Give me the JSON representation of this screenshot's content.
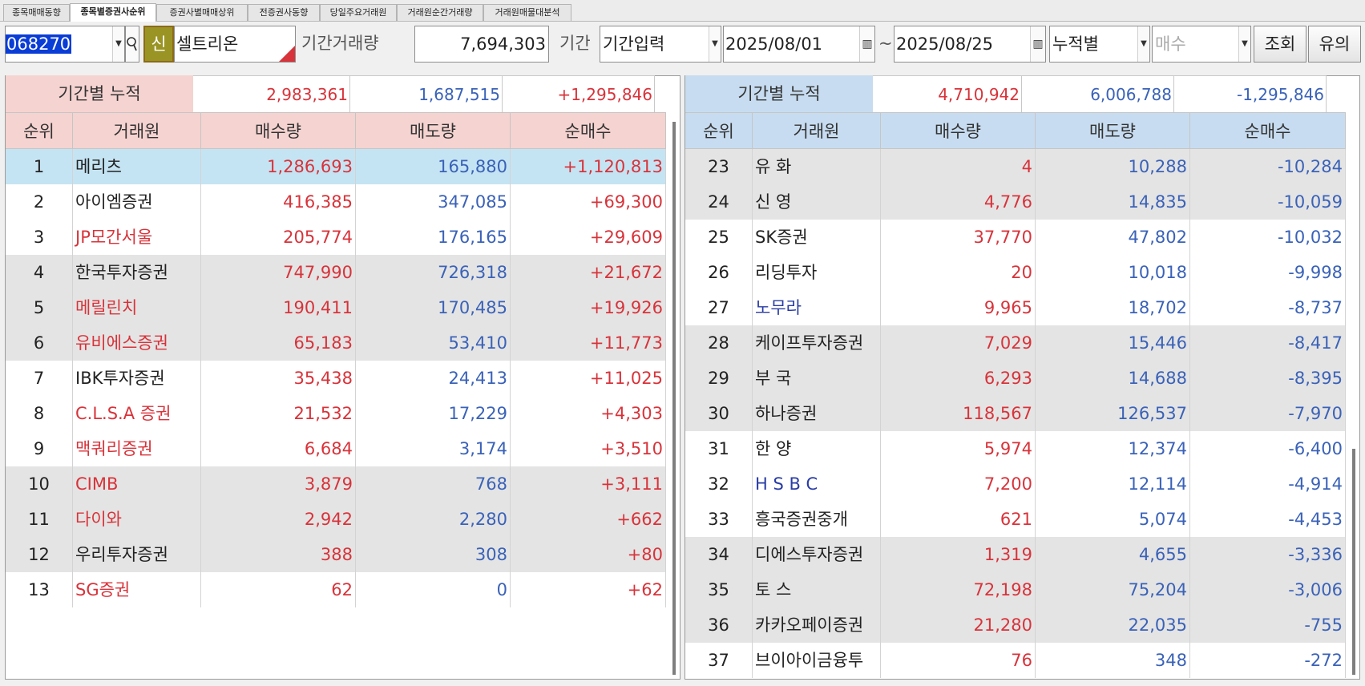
{
  "tabs": [
    "종목매매동향",
    "종목별증권사순위",
    "증권사별매매상위",
    "전증권사동향",
    "당일주요거래원",
    "거래원순간거래량",
    "거래원매물대분석"
  ],
  "active_tab": 1,
  "toolbar": {
    "code": "068270",
    "badge": "신",
    "stock_name": "셀트리온",
    "volume_label": "기간거래량",
    "volume_value": "7,694,303",
    "period_label": "기간",
    "period_mode": "기간입력",
    "date_from": "2025/08/01",
    "tilde": "~",
    "date_to": "2025/08/25",
    "accum_mode": "누적별",
    "side": "매수",
    "query_btn": "조회",
    "note_btn": "유의"
  },
  "left": {
    "cum_label": "기간별 누적",
    "cum_buy": "2,983,361",
    "cum_sell": "1,687,515",
    "cum_net": "+1,295,846",
    "headers": [
      "순위",
      "거래원",
      "매수량",
      "매도량",
      "순매수"
    ],
    "rows": [
      {
        "rank": "1",
        "name": "메리츠",
        "buy": "1,286,693",
        "sell": "165,880",
        "net": "+1,120,813",
        "name_color": "dark",
        "bg": "sel"
      },
      {
        "rank": "2",
        "name": "아이엠증권",
        "buy": "416,385",
        "sell": "347,085",
        "net": "+69,300",
        "name_color": "dark",
        "bg": "white"
      },
      {
        "rank": "3",
        "name": "JP모간서울",
        "buy": "205,774",
        "sell": "176,165",
        "net": "+29,609",
        "name_color": "red",
        "bg": "white"
      },
      {
        "rank": "4",
        "name": "한국투자증권",
        "buy": "747,990",
        "sell": "726,318",
        "net": "+21,672",
        "name_color": "dark",
        "bg": "gray"
      },
      {
        "rank": "5",
        "name": "메릴린치",
        "buy": "190,411",
        "sell": "170,485",
        "net": "+19,926",
        "name_color": "red",
        "bg": "gray"
      },
      {
        "rank": "6",
        "name": "유비에스증권",
        "buy": "65,183",
        "sell": "53,410",
        "net": "+11,773",
        "name_color": "red",
        "bg": "gray"
      },
      {
        "rank": "7",
        "name": "IBK투자증권",
        "buy": "35,438",
        "sell": "24,413",
        "net": "+11,025",
        "name_color": "dark",
        "bg": "white"
      },
      {
        "rank": "8",
        "name": "C.L.S.A 증권",
        "buy": "21,532",
        "sell": "17,229",
        "net": "+4,303",
        "name_color": "red",
        "bg": "white"
      },
      {
        "rank": "9",
        "name": "맥쿼리증권",
        "buy": "6,684",
        "sell": "3,174",
        "net": "+3,510",
        "name_color": "red",
        "bg": "white"
      },
      {
        "rank": "10",
        "name": "CIMB",
        "buy": "3,879",
        "sell": "768",
        "net": "+3,111",
        "name_color": "red",
        "bg": "gray"
      },
      {
        "rank": "11",
        "name": "다이와",
        "buy": "2,942",
        "sell": "2,280",
        "net": "+662",
        "name_color": "red",
        "bg": "gray"
      },
      {
        "rank": "12",
        "name": "우리투자증권",
        "buy": "388",
        "sell": "308",
        "net": "+80",
        "name_color": "dark",
        "bg": "gray"
      },
      {
        "rank": "13",
        "name": "SG증권",
        "buy": "62",
        "sell": "0",
        "net": "+62",
        "name_color": "red",
        "bg": "white"
      }
    ]
  },
  "right": {
    "cum_label": "기간별 누적",
    "cum_buy": "4,710,942",
    "cum_sell": "6,006,788",
    "cum_net": "-1,295,846",
    "headers": [
      "순위",
      "거래원",
      "매수량",
      "매도량",
      "순매수"
    ],
    "rows": [
      {
        "rank": "23",
        "name": "유 화",
        "buy": "4",
        "sell": "10,288",
        "net": "-10,284",
        "name_color": "dark",
        "bg": "gray"
      },
      {
        "rank": "24",
        "name": "신 영",
        "buy": "4,776",
        "sell": "14,835",
        "net": "-10,059",
        "name_color": "dark",
        "bg": "gray"
      },
      {
        "rank": "25",
        "name": "SK증권",
        "buy": "37,770",
        "sell": "47,802",
        "net": "-10,032",
        "name_color": "dark",
        "bg": "white"
      },
      {
        "rank": "26",
        "name": "리딩투자",
        "buy": "20",
        "sell": "10,018",
        "net": "-9,998",
        "name_color": "dark",
        "bg": "white"
      },
      {
        "rank": "27",
        "name": "노무라",
        "buy": "9,965",
        "sell": "18,702",
        "net": "-8,737",
        "name_color": "navy",
        "bg": "white"
      },
      {
        "rank": "28",
        "name": "케이프투자증권",
        "buy": "7,029",
        "sell": "15,446",
        "net": "-8,417",
        "name_color": "dark",
        "bg": "gray"
      },
      {
        "rank": "29",
        "name": "부 국",
        "buy": "6,293",
        "sell": "14,688",
        "net": "-8,395",
        "name_color": "dark",
        "bg": "gray"
      },
      {
        "rank": "30",
        "name": "하나증권",
        "buy": "118,567",
        "sell": "126,537",
        "net": "-7,970",
        "name_color": "dark",
        "bg": "gray"
      },
      {
        "rank": "31",
        "name": "한 양",
        "buy": "5,974",
        "sell": "12,374",
        "net": "-6,400",
        "name_color": "dark",
        "bg": "white"
      },
      {
        "rank": "32",
        "name": "H S B C",
        "buy": "7,200",
        "sell": "12,114",
        "net": "-4,914",
        "name_color": "navy",
        "bg": "white"
      },
      {
        "rank": "33",
        "name": "흥국증권중개",
        "buy": "621",
        "sell": "5,074",
        "net": "-4,453",
        "name_color": "dark",
        "bg": "white"
      },
      {
        "rank": "34",
        "name": "디에스투자증권",
        "buy": "1,319",
        "sell": "4,655",
        "net": "-3,336",
        "name_color": "dark",
        "bg": "gray"
      },
      {
        "rank": "35",
        "name": "토 스",
        "buy": "72,198",
        "sell": "75,204",
        "net": "-3,006",
        "name_color": "dark",
        "bg": "gray"
      },
      {
        "rank": "36",
        "name": "카카오페이증권",
        "buy": "21,280",
        "sell": "22,035",
        "net": "-755",
        "name_color": "dark",
        "bg": "gray"
      },
      {
        "rank": "37",
        "name": "브이아이금융투",
        "buy": "76",
        "sell": "348",
        "net": "-272",
        "name_color": "dark",
        "bg": "white"
      }
    ]
  },
  "colors": {
    "left_header_bg": "#f5d3d0",
    "right_header_bg": "#c7dcf0",
    "selected_row_bg": "#c5e4f3",
    "gray_row_bg": "#e4e4e4",
    "buy_red": "#d8333a",
    "sell_blue": "#3a62b8"
  }
}
